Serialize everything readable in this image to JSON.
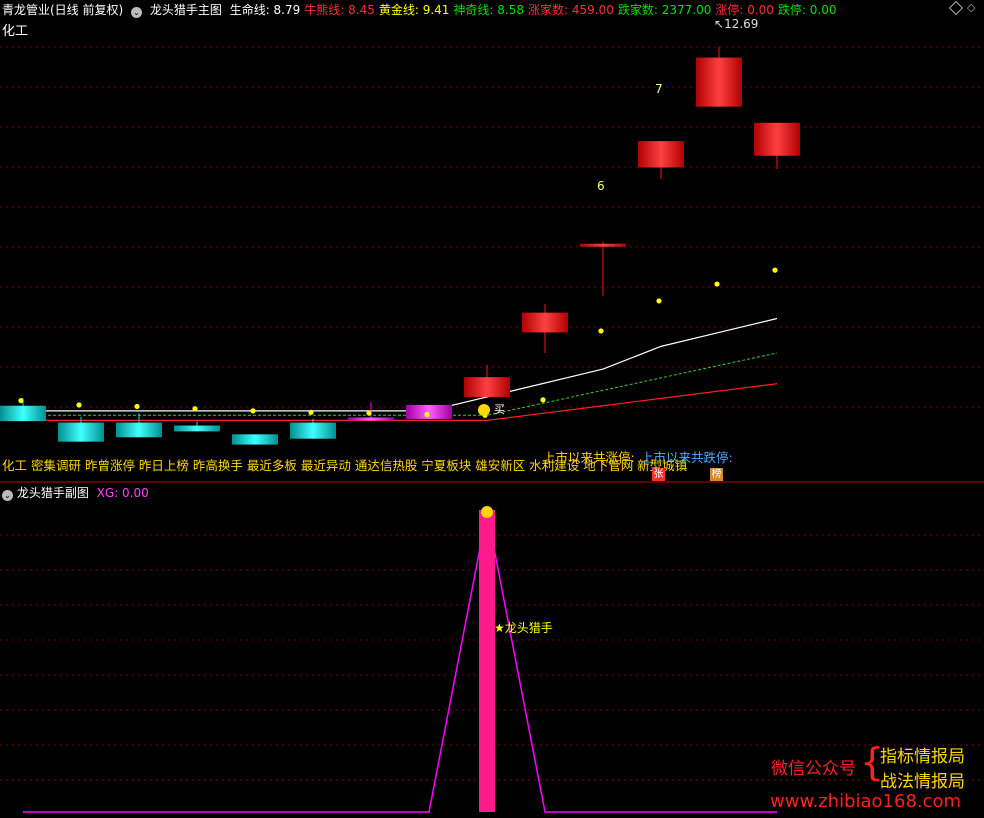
{
  "main_header": {
    "stock": "青龙管业(日线 前复权)",
    "indicator": "龙头猎手主图",
    "lines": [
      {
        "label": "生命线: 8.79",
        "color": "#ffffff"
      },
      {
        "label": "牛熊线: 8.45",
        "color": "#ff3030"
      },
      {
        "label": "黄金线: 9.41",
        "color": "#ffff00"
      },
      {
        "label": "神奇线: 8.58",
        "color": "#00e000"
      },
      {
        "label": "涨家数: 459.00",
        "color": "#ff3030"
      },
      {
        "label": "跌家数: 2377.00",
        "color": "#00e000"
      },
      {
        "label": "涨停: 0.00",
        "color": "#ff3030"
      },
      {
        "label": "跌停: 0.00",
        "color": "#00e000"
      }
    ]
  },
  "sector_label": "化工",
  "chart_labels": {
    "high_price": "12.69",
    "board_6": "6",
    "board_7": "7",
    "buy_text": "买"
  },
  "concepts": "化工 密集调研 昨曾涨停 昨日上榜 昨高换手 最近多板 最近异动 通达信热股 宁夏板块 雄安新区 水利建设 地下管网 新型城镇",
  "limit_up_text": "上市以来共涨停:",
  "limit_down_text": "上市以来共跌停:",
  "badge_zhang": "张",
  "badge_bang": "榜",
  "sub_header": {
    "indicator": "龙头猎手副图",
    "xg": "XG: 0.00"
  },
  "signal_label": "★龙头猎手",
  "watermark": {
    "wechat": "微信公众号",
    "line1": "指标情报局",
    "line2": "战法情报局",
    "url": "www.zhibiao168.com"
  },
  "colors": {
    "up": "#ff1010",
    "down": "#00d8d8",
    "flat": "#ff00ff",
    "signal": "#ff1a8c",
    "grid": "#7a0000"
  },
  "chart_data": {
    "type": "candlestick",
    "candles": [
      {
        "o": 7.79,
        "h": 7.89,
        "l": 7.58,
        "c": 7.58,
        "kind": "down"
      },
      {
        "o": 7.56,
        "h": 7.64,
        "l": 7.3,
        "c": 7.3,
        "kind": "down"
      },
      {
        "o": 7.56,
        "h": 7.69,
        "l": 7.36,
        "c": 7.36,
        "kind": "down"
      },
      {
        "o": 7.52,
        "h": 7.58,
        "l": 7.44,
        "c": 7.44,
        "kind": "down"
      },
      {
        "o": 7.4,
        "h": 7.4,
        "l": 7.26,
        "c": 7.26,
        "kind": "down"
      },
      {
        "o": 7.56,
        "h": 7.61,
        "l": 7.34,
        "c": 7.34,
        "kind": "down"
      },
      {
        "o": 7.61,
        "h": 7.84,
        "l": 7.59,
        "c": 7.63,
        "kind": "flat"
      },
      {
        "o": 7.61,
        "h": 7.8,
        "l": 7.61,
        "c": 7.8,
        "kind": "flat"
      },
      {
        "o": 7.91,
        "h": 8.35,
        "l": 7.91,
        "c": 8.18,
        "kind": "up"
      },
      {
        "o": 8.79,
        "h": 9.18,
        "l": 8.51,
        "c": 9.06,
        "kind": "up"
      },
      {
        "o": 10.0,
        "h": 10.03,
        "l": 9.29,
        "c": 9.97,
        "kind": "up"
      },
      {
        "o": 11.04,
        "h": 11.4,
        "l": 10.88,
        "c": 11.4,
        "kind": "up"
      },
      {
        "o": 11.87,
        "h": 12.69,
        "l": 11.87,
        "c": 12.54,
        "kind": "up"
      },
      {
        "o": 11.65,
        "h": 11.62,
        "l": 11.02,
        "c": 11.2,
        "kind": "up"
      }
    ],
    "dots": [
      7.86,
      7.8,
      7.78,
      7.75,
      7.72,
      7.7,
      7.69,
      7.67,
      7.66,
      7.87,
      8.81,
      9.22,
      9.45,
      9.64
    ],
    "board_labels": [
      {
        "index": 10,
        "text": "6"
      },
      {
        "index": 11,
        "text": "7"
      }
    ],
    "sub_signal": {
      "index": 8
    }
  }
}
